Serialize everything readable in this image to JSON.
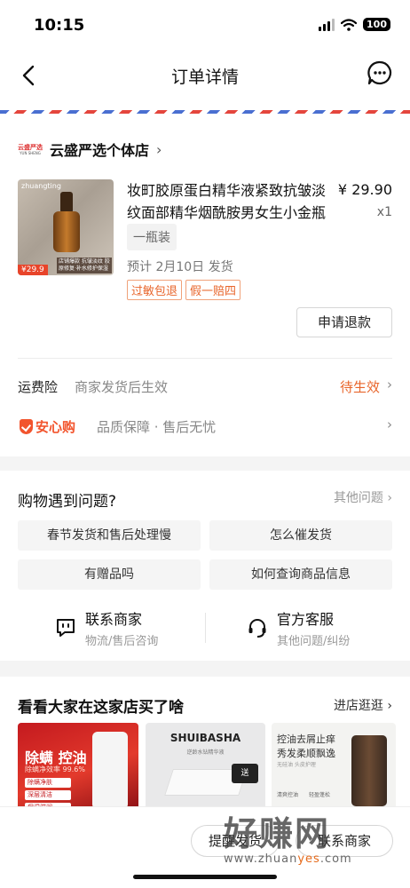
{
  "status_bar": {
    "time": "10:15",
    "battery": "100"
  },
  "nav": {
    "title": "订单详情"
  },
  "shop": {
    "logo_line1": "云盛严选",
    "logo_line2": "YUN SHENG",
    "name": "云盛严选个体店"
  },
  "product": {
    "title": "妆町胶原蛋白精华液紧致抗皱淡纹面部精华烟酰胺男女生小金瓶",
    "price": "¥ 29.90",
    "quantity": "x1",
    "variant": "一瓶装",
    "ship_date": "预计 2月10日 发货",
    "tags": [
      "过敏包退",
      "假一赔四"
    ],
    "image_brand": "zhuangting",
    "image_price": "¥29.9",
    "image_subtag": "店铺爆款 抗皱淡纹 胶原修复·补水修护保湿",
    "refund_label": "申请退款"
  },
  "insurance": {
    "label": "运费险",
    "description": "商家发货后生效",
    "status": "待生效"
  },
  "anxingou": {
    "label": "安心购",
    "description": "品质保障 · 售后无忧"
  },
  "help": {
    "title": "购物遇到问题?",
    "more": "其他问题",
    "questions": [
      "春节发货和售后处理慢",
      "怎么催发货",
      "有赠品吗",
      "如何查询商品信息"
    ],
    "contacts": [
      {
        "title": "联系商家",
        "subtitle": "物流/售后咨询"
      },
      {
        "title": "官方客服",
        "subtitle": "其他问题/纠纷"
      }
    ]
  },
  "recommend": {
    "title": "看看大家在这家店买了啥",
    "more": "进店逛逛",
    "items": [
      {
        "headline": "除螨 控油",
        "sub": "除螨净效率 99.6%",
        "pills": [
          "除螨净肤",
          "深层清洁",
          "保湿滋润"
        ]
      },
      {
        "brand": "SHUIBASHA",
        "sub": "逆龄水钻精华液",
        "badge": "送"
      },
      {
        "line1": "控油去屑止痒",
        "line2": "秀发柔顺飘逸",
        "line3": "无硅油 头皮护理",
        "features": [
          "清爽控油",
          "轻盈蓬松"
        ]
      }
    ]
  },
  "bottom": {
    "btn1": "提醒发货",
    "btn2": "联系商家"
  },
  "watermark": {
    "main": "好赚网",
    "url_prefix": "www.zhuan",
    "url_accent": "yes",
    "url_suffix": ".com"
  },
  "colors": {
    "accent": "#e8652b",
    "anxingou": "#f2542d",
    "price_tag": "#e8442a"
  }
}
